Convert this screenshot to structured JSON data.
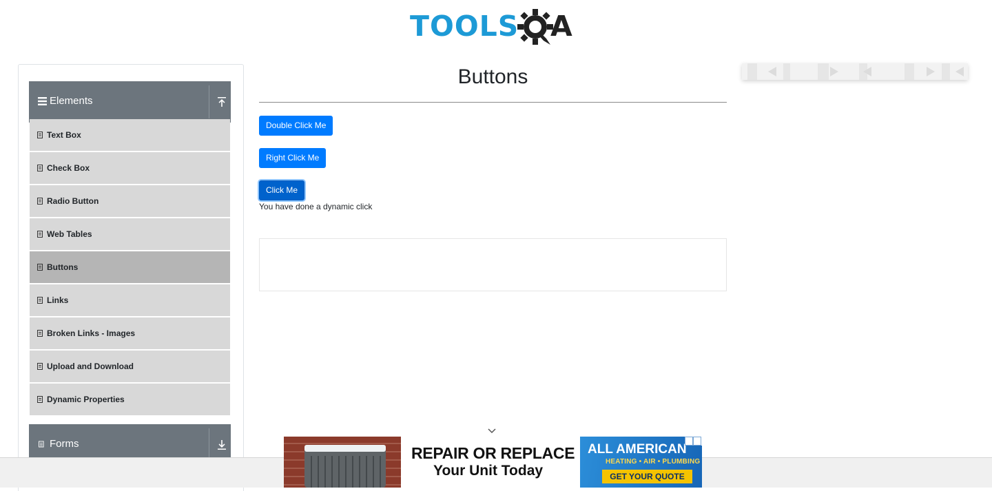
{
  "header": {
    "logo_text": "TOOLS",
    "logo_suffix": "A"
  },
  "sidebar": {
    "groups": [
      {
        "title": "Elements",
        "icon": "hamburger-icon",
        "toggle_icon": "arrow-up-icon"
      },
      {
        "title": "Forms",
        "icon": "document-icon",
        "toggle_icon": "arrow-down-icon"
      }
    ],
    "items": [
      {
        "label": "Text Box"
      },
      {
        "label": "Check Box"
      },
      {
        "label": "Radio Button"
      },
      {
        "label": "Web Tables"
      },
      {
        "label": "Buttons",
        "active": true
      },
      {
        "label": "Links"
      },
      {
        "label": "Broken Links - Images"
      },
      {
        "label": "Upload and Download"
      },
      {
        "label": "Dynamic Properties"
      }
    ]
  },
  "main": {
    "title": "Buttons",
    "buttons": {
      "double_click": "Double Click Me",
      "right_click": "Right Click Me",
      "click": "Click Me"
    },
    "message": "You have done a dynamic click"
  },
  "ad": {
    "headline": "REPAIR OR REPLACE",
    "subline": "Your Unit Today",
    "brand": "ALL AMERICAN",
    "tagline": "HEATING • AIR • PLUMBING",
    "cta": "GET YOUR QUOTE"
  },
  "colors": {
    "primary": "#007bff",
    "sidebar_header": "#6c757d",
    "menu_item": "#d8d8d8",
    "menu_item_active": "#b5b5b5",
    "logo_blue": "#1d9ad6"
  }
}
